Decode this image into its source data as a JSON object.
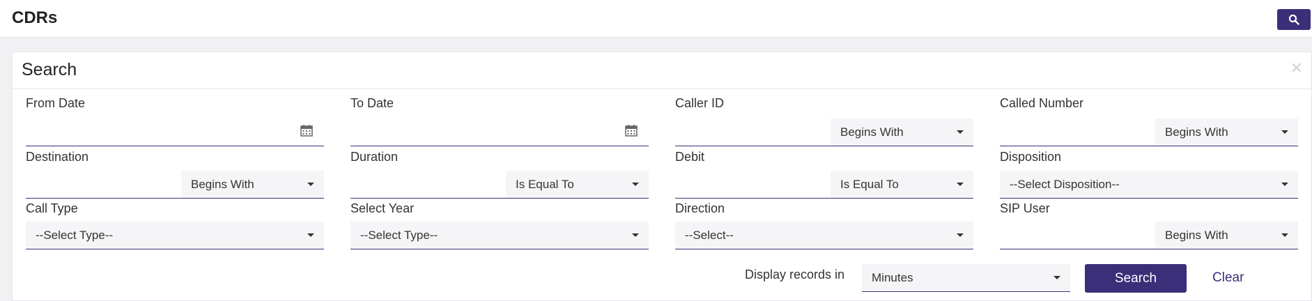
{
  "header": {
    "title": "CDRs",
    "search_icon": "search-icon"
  },
  "panel": {
    "title": "Search",
    "close_icon": "close-icon"
  },
  "fields": {
    "from_date": {
      "label": "From Date"
    },
    "to_date": {
      "label": "To Date"
    },
    "caller_id": {
      "label": "Caller ID",
      "operator": "Begins With"
    },
    "called_number": {
      "label": "Called Number",
      "operator": "Begins With"
    },
    "destination": {
      "label": "Destination",
      "operator": "Begins With"
    },
    "duration": {
      "label": "Duration",
      "operator": "Is Equal To"
    },
    "debit": {
      "label": "Debit",
      "operator": "Is Equal To"
    },
    "disposition": {
      "label": "Disposition",
      "value": "--Select Disposition--"
    },
    "call_type": {
      "label": "Call Type",
      "value": "--Select Type--"
    },
    "select_year": {
      "label": "Select Year",
      "value": "--Select Type--"
    },
    "direction": {
      "label": "Direction",
      "value": "--Select--"
    },
    "sip_user": {
      "label": "SIP User",
      "operator": "Begins With"
    }
  },
  "footer": {
    "display_label": "Display records in",
    "display_value": "Minutes",
    "search_label": "Search",
    "clear_label": "Clear"
  },
  "colors": {
    "accent": "#3a2f78"
  }
}
